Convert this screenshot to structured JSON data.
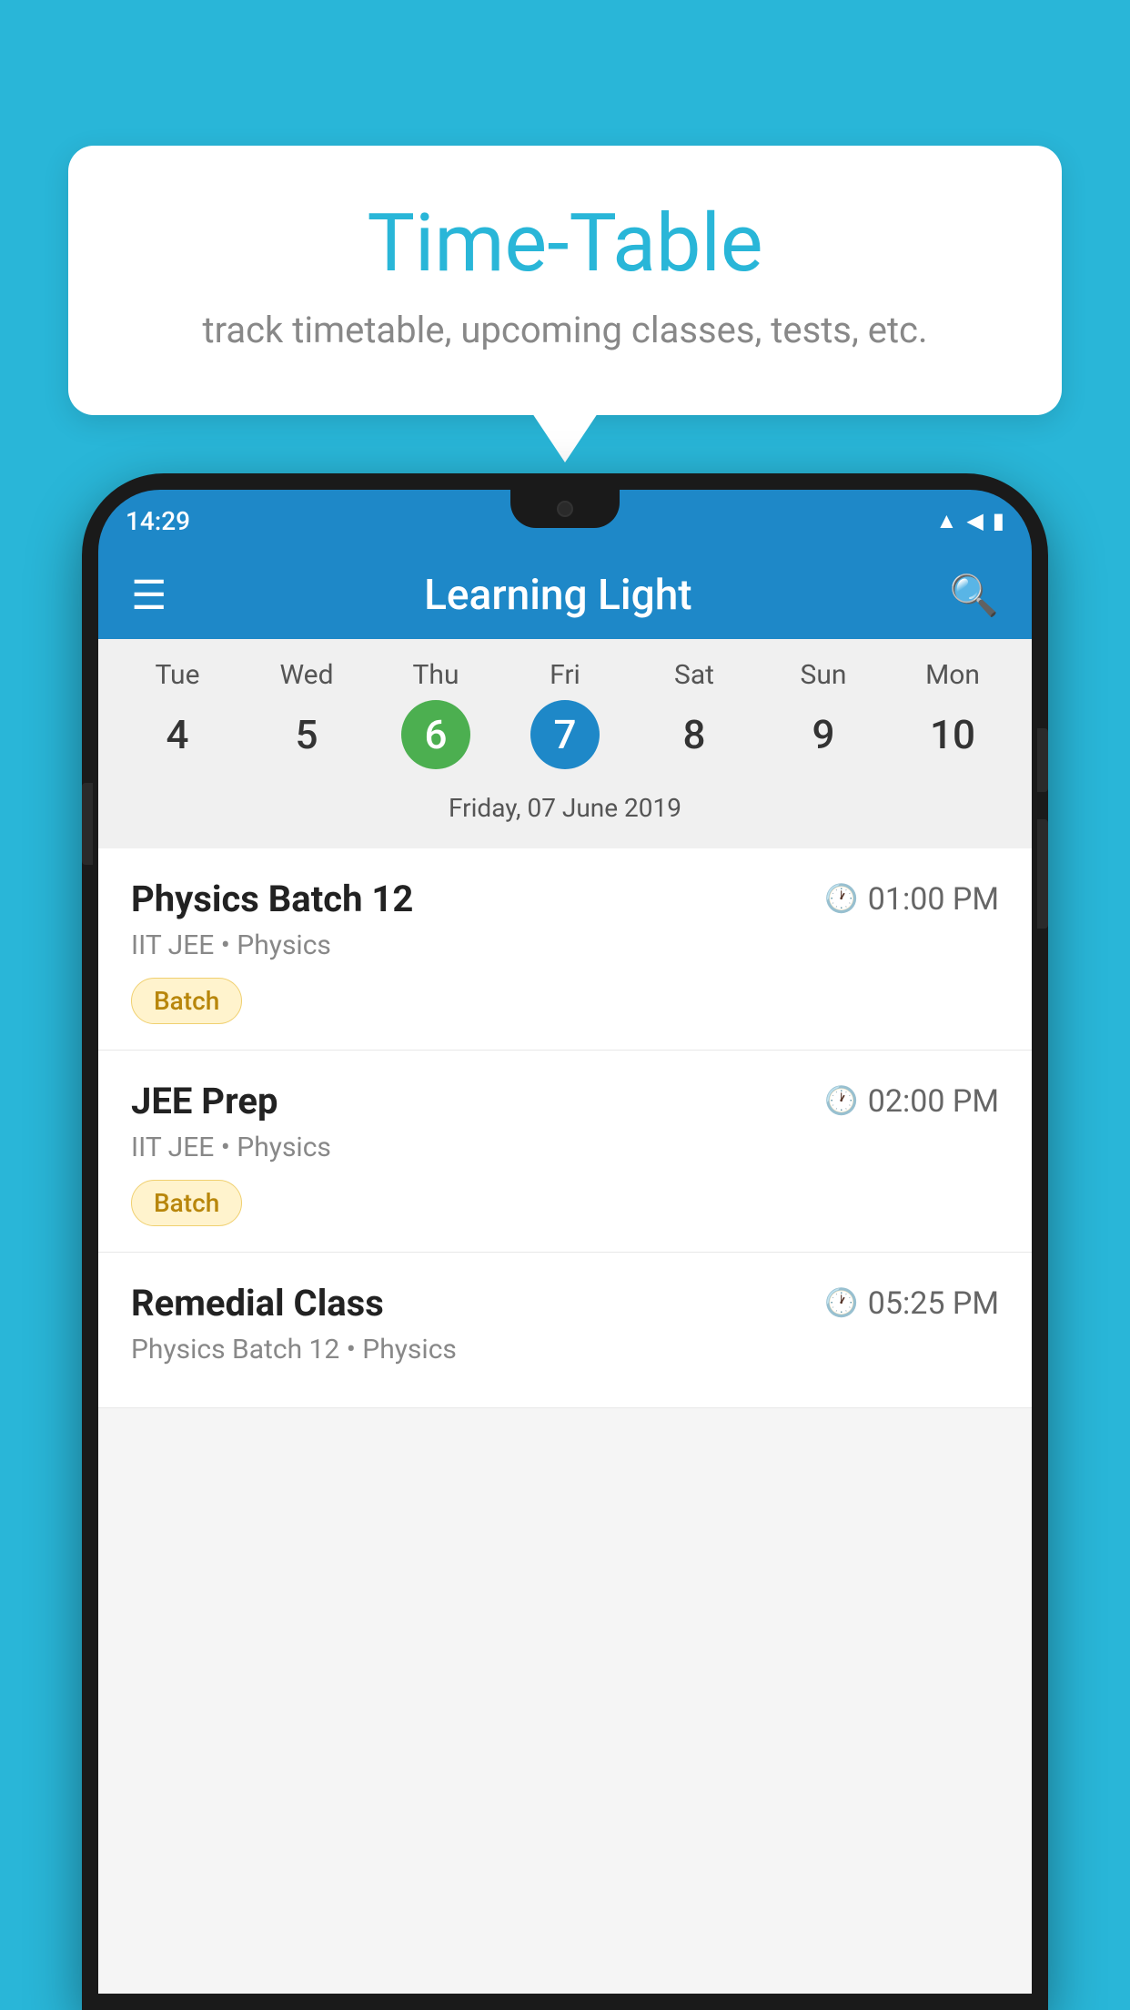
{
  "background_color": "#29b6d8",
  "speech_bubble": {
    "title": "Time-Table",
    "subtitle": "track timetable, upcoming classes, tests, etc."
  },
  "phone": {
    "status_bar": {
      "time": "14:29"
    },
    "app_header": {
      "title": "Learning Light"
    },
    "calendar": {
      "days": [
        {
          "name": "Tue",
          "number": "4",
          "state": "normal"
        },
        {
          "name": "Wed",
          "number": "5",
          "state": "normal"
        },
        {
          "name": "Thu",
          "number": "6",
          "state": "today"
        },
        {
          "name": "Fri",
          "number": "7",
          "state": "selected"
        },
        {
          "name": "Sat",
          "number": "8",
          "state": "normal"
        },
        {
          "name": "Sun",
          "number": "9",
          "state": "normal"
        },
        {
          "name": "Mon",
          "number": "10",
          "state": "normal"
        }
      ],
      "selected_date_label": "Friday, 07 June 2019"
    },
    "schedule": [
      {
        "title": "Physics Batch 12",
        "time": "01:00 PM",
        "subtitle": "IIT JEE • Physics",
        "badge": "Batch"
      },
      {
        "title": "JEE Prep",
        "time": "02:00 PM",
        "subtitle": "IIT JEE • Physics",
        "badge": "Batch"
      },
      {
        "title": "Remedial Class",
        "time": "05:25 PM",
        "subtitle": "Physics Batch 12 • Physics",
        "badge": null
      }
    ]
  }
}
